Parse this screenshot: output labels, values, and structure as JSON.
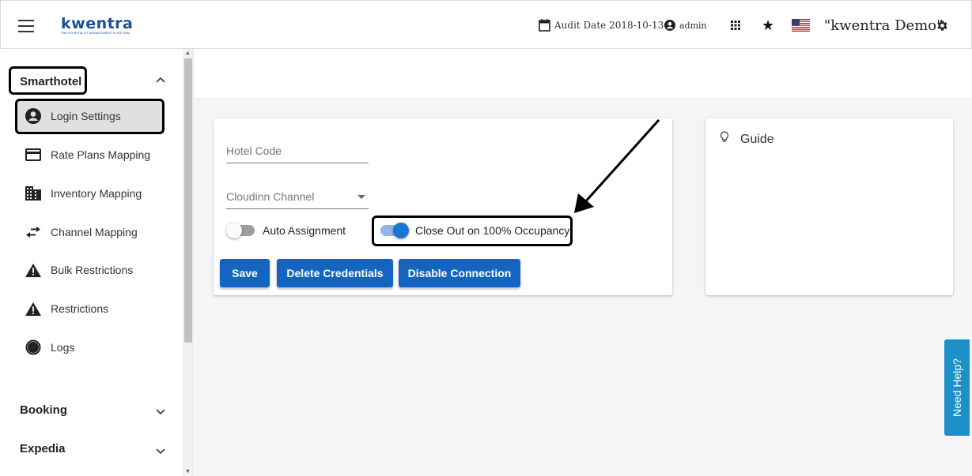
{
  "header": {
    "logo_text": "kwentra",
    "logo_tagline": "THE HOSPITALITY MANAGEMENT PLATFORM",
    "audit_date": "Audit Date 2018-10-13",
    "user": "admin",
    "company": "\"kwentra Demo\""
  },
  "sidebar": {
    "sections": [
      {
        "title": "Smarthotel",
        "expanded": true,
        "items": [
          {
            "label": "Login Settings",
            "icon": "account-circle-icon",
            "active": true
          },
          {
            "label": "Rate Plans Mapping",
            "icon": "credit-card-icon"
          },
          {
            "label": "Inventory Mapping",
            "icon": "building-icon"
          },
          {
            "label": "Channel Mapping",
            "icon": "swap-arrows-icon"
          },
          {
            "label": "Bulk Restrictions",
            "icon": "warning-icon"
          },
          {
            "label": "Restrictions",
            "icon": "warning-icon"
          },
          {
            "label": "Logs",
            "icon": "logs-icon"
          }
        ]
      },
      {
        "title": "Booking",
        "expanded": false
      },
      {
        "title": "Expedia",
        "expanded": false
      }
    ]
  },
  "form": {
    "hotel_code_placeholder": "Hotel Code",
    "channel_placeholder": "Cloudinn Channel",
    "auto_assignment_label": "Auto Assignment",
    "auto_assignment_on": false,
    "close_out_label": "Close Out on 100% Occupancy",
    "close_out_on": true,
    "buttons": {
      "save": "Save",
      "delete": "Delete Credentials",
      "disable": "Disable Connection"
    }
  },
  "guide": {
    "title": "Guide"
  },
  "help": {
    "label": "Need Help?"
  },
  "colors": {
    "primary": "#1565c0",
    "brand": "#1d4f91",
    "help_tab": "#1e90c8",
    "toggle_on": "#1976d2"
  }
}
